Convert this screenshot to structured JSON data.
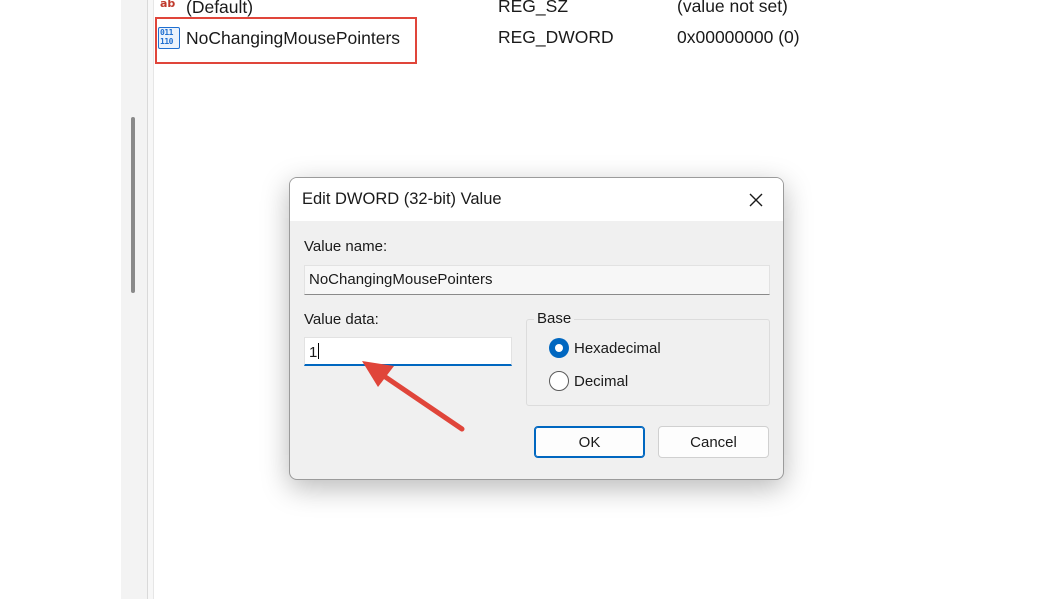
{
  "registry_list": {
    "rows": [
      {
        "icon": "string-value-icon",
        "icon_text": "ab",
        "name": "(Default)",
        "type": "REG_SZ",
        "data": "(value not set)"
      },
      {
        "icon": "dword-value-icon",
        "icon_text": "011\n110",
        "name": "NoChangingMousePointers",
        "type": "REG_DWORD",
        "data": "0x00000000 (0)"
      }
    ]
  },
  "dialog": {
    "title": "Edit DWORD (32-bit) Value",
    "value_name_label": "Value name:",
    "value_name": "NoChangingMousePointers",
    "value_data_label": "Value data:",
    "value_data": "1",
    "base_label": "Base",
    "base_options": [
      {
        "label": "Hexadecimal",
        "selected": true
      },
      {
        "label": "Decimal",
        "selected": false
      }
    ],
    "ok_label": "OK",
    "cancel_label": "Cancel"
  },
  "colors": {
    "accent": "#0067c0",
    "annotation": "#e0453a"
  }
}
